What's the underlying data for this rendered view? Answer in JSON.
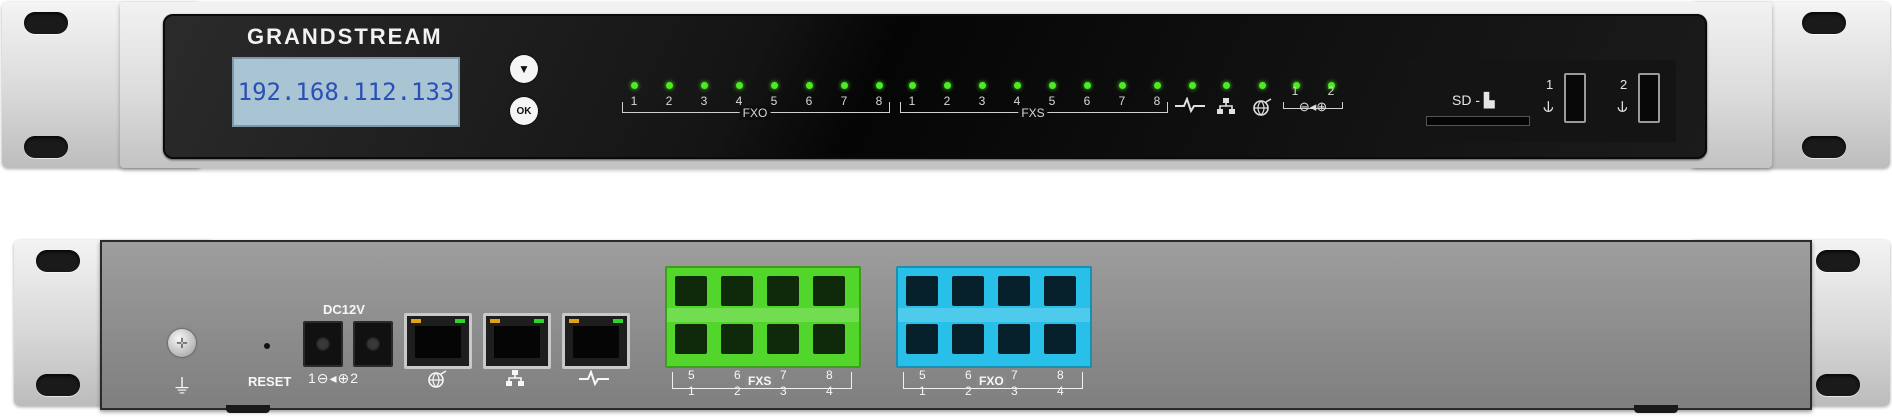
{
  "front": {
    "brand": "GRANDSTREAM",
    "lcd_text": "192.168.112.133",
    "down_button_glyph": "▼",
    "ok_button_label": "OK",
    "fxo_numbers": [
      "1",
      "2",
      "3",
      "4",
      "5",
      "6",
      "7",
      "8"
    ],
    "fxo_label": "FXO",
    "fxs_numbers": [
      "1",
      "2",
      "3",
      "4",
      "5",
      "6",
      "7",
      "8"
    ],
    "fxs_label": "FXS",
    "status_icons": [
      "heartbeat-icon",
      "lan-icon",
      "wan-icon"
    ],
    "power_numbers": [
      "1",
      "2"
    ],
    "sd_label": "SD -",
    "usb_numbers": [
      "1",
      "2"
    ],
    "led_color": "#4eea23"
  },
  "rear": {
    "dc_label": "DC12V",
    "reset_label": "RESET",
    "dc_jack_numbers": [
      "1",
      "2"
    ],
    "fxs_label": "FXS",
    "fxs_top_numbers": [
      "5",
      "6",
      "7",
      "8"
    ],
    "fxs_bottom_numbers": [
      "1",
      "2",
      "3",
      "4"
    ],
    "fxo_label": "FXO",
    "fxo_top_numbers": [
      "5",
      "6",
      "7",
      "8"
    ],
    "fxo_bottom_numbers": [
      "1",
      "2",
      "3",
      "4"
    ],
    "fxs_color": "#53d62b",
    "fxo_color": "#28c0e8"
  }
}
